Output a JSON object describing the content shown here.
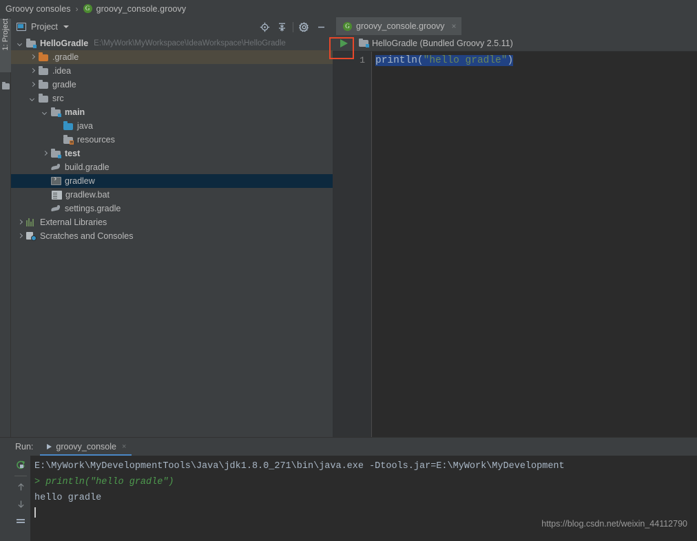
{
  "breadcrumb": {
    "root": "Groovy consoles",
    "separator": "›",
    "file": "groovy_console.groovy",
    "file_icon": "groovy-icon",
    "file_icon_letter": "G"
  },
  "left_rail": {
    "tab_label": "1: Project"
  },
  "project_panel": {
    "title": "Project",
    "tools": [
      {
        "name": "locate-icon",
        "tooltip": "Select Opened File"
      },
      {
        "name": "collapse-all-icon",
        "tooltip": "Collapse All"
      },
      {
        "name": "gear-icon",
        "tooltip": "Settings"
      },
      {
        "name": "minimize-icon",
        "tooltip": "Hide"
      }
    ],
    "tree": [
      {
        "label": "HelloGradle",
        "path": "E:\\MyWork\\MyWorkspace\\IdeaWorkspace\\HelloGradle",
        "indent": 0,
        "arrow": "down",
        "icon": "module-folder-icon",
        "bold": true,
        "state": "normal"
      },
      {
        "label": ".gradle",
        "path": "",
        "indent": 1,
        "arrow": "right",
        "icon": "folder-orange-icon",
        "bold": false,
        "state": "hover"
      },
      {
        "label": ".idea",
        "path": "",
        "indent": 1,
        "arrow": "right",
        "icon": "folder-grey-icon",
        "bold": false,
        "state": "normal"
      },
      {
        "label": "gradle",
        "path": "",
        "indent": 1,
        "arrow": "right",
        "icon": "folder-grey-icon",
        "bold": false,
        "state": "normal"
      },
      {
        "label": "src",
        "path": "",
        "indent": 1,
        "arrow": "down",
        "icon": "folder-grey-icon",
        "bold": false,
        "state": "normal"
      },
      {
        "label": "main",
        "path": "",
        "indent": 2,
        "arrow": "down",
        "icon": "module-folder-icon",
        "bold": true,
        "state": "normal"
      },
      {
        "label": "java",
        "path": "",
        "indent": 3,
        "arrow": "none",
        "icon": "folder-source-icon",
        "bold": false,
        "state": "normal"
      },
      {
        "label": "resources",
        "path": "",
        "indent": 3,
        "arrow": "none",
        "icon": "folder-resources-icon",
        "bold": false,
        "state": "normal"
      },
      {
        "label": "test",
        "path": "",
        "indent": 2,
        "arrow": "right",
        "icon": "module-folder-icon",
        "bold": true,
        "state": "normal"
      },
      {
        "label": "build.gradle",
        "path": "",
        "indent": 2,
        "arrow": "none",
        "icon": "gradle-file-icon",
        "bold": false,
        "state": "normal"
      },
      {
        "label": "gradlew",
        "path": "",
        "indent": 2,
        "arrow": "none",
        "icon": "shell-script-icon",
        "bold": false,
        "state": "selected"
      },
      {
        "label": "gradlew.bat",
        "path": "",
        "indent": 2,
        "arrow": "none",
        "icon": "bat-file-icon",
        "bold": false,
        "state": "normal"
      },
      {
        "label": "settings.gradle",
        "path": "",
        "indent": 2,
        "arrow": "none",
        "icon": "gradle-file-icon",
        "bold": false,
        "state": "normal"
      },
      {
        "label": "External Libraries",
        "path": "",
        "indent": 0,
        "arrow": "right",
        "icon": "external-libraries-icon",
        "bold": false,
        "state": "normal"
      },
      {
        "label": "Scratches and Consoles",
        "path": "",
        "indent": 0,
        "arrow": "right",
        "icon": "scratches-icon",
        "bold": false,
        "state": "normal"
      }
    ]
  },
  "editor": {
    "tab": {
      "label": "groovy_console.groovy",
      "icon_letter": "G",
      "close_glyph": "×"
    },
    "run_toolbar": {
      "run_button": "run-icon",
      "config_label": "HelloGradle (Bundled Groovy 2.5.11)"
    },
    "line_number": "1",
    "code": {
      "prefix": "println(",
      "string": "\"hello gradle\"",
      "suffix": ")"
    }
  },
  "run_panel": {
    "label": "Run:",
    "tab_label": "groovy_console",
    "tab_close_glyph": "×",
    "sidebar_buttons": [
      {
        "name": "rerun-icon"
      },
      {
        "name": "arrow-up-icon"
      },
      {
        "name": "arrow-down-icon"
      },
      {
        "name": "soft-wrap-icon"
      }
    ],
    "console_lines": [
      {
        "text": "E:\\MyWork\\MyDevelopmentTools\\Java\\jdk1.8.0_271\\bin\\java.exe -Dtools.jar=E:\\MyWork\\MyDevelopment",
        "style": "plain"
      },
      {
        "text": "> println(\"hello gradle\")",
        "style": "command"
      },
      {
        "text": "hello gradle",
        "style": "plain"
      }
    ],
    "watermark": "https://blog.csdn.net/weixin_44112790"
  },
  "colors": {
    "background": "#3c3f41",
    "editor_background": "#2b2b2b",
    "selection_blue": "#214283",
    "tree_selected": "#0d293e",
    "tree_hover": "#4e4a3f",
    "accent_blue": "#4a88c7",
    "run_green": "#4d9a51",
    "annotation_red": "#e8482a",
    "string_green": "#6a8759"
  }
}
